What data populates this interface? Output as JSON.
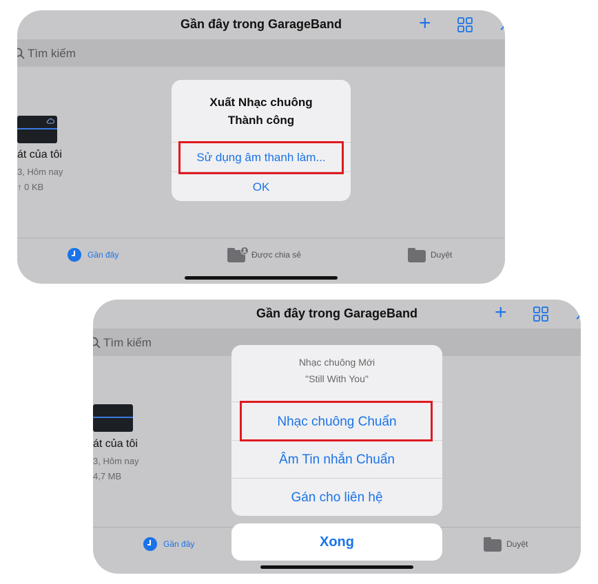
{
  "screen1": {
    "title": "Gần đây trong GarageBand",
    "search_placeholder": "Tìm kiếm",
    "file": {
      "name": "át của tôi",
      "date": "3, Hôm nay",
      "size": "↑ 0 KB"
    },
    "alert": {
      "title_line1": "Xuất Nhạc chuông",
      "title_line2": "Thành công",
      "use_sound_label": "Sử dụng âm thanh làm...",
      "ok_label": "OK"
    },
    "tabs": [
      {
        "label": "Gần đây",
        "icon": "clock-icon",
        "active": true
      },
      {
        "label": "Được chia sẻ",
        "icon": "shared-folder-icon",
        "active": false
      },
      {
        "label": "Duyệt",
        "icon": "folder-icon",
        "active": false
      }
    ]
  },
  "screen2": {
    "title": "Gần đây trong GarageBand",
    "search_placeholder": "Tìm kiếm",
    "file": {
      "name": "át của tôi",
      "date": "3, Hôm nay",
      "size": "4,7 MB"
    },
    "sheet": {
      "heading": "Nhạc chuông Mới",
      "subheading": "\"Still With You\"",
      "options": [
        "Nhạc chuông Chuẩn",
        "Âm Tin nhắn Chuẩn",
        "Gán cho liên hệ"
      ],
      "done_label": "Xong"
    },
    "tabs": [
      {
        "label": "Gần đây",
        "icon": "clock-icon",
        "active": true
      },
      {
        "label": "Duyệt",
        "icon": "folder-icon",
        "active": false
      }
    ]
  },
  "colors": {
    "accent": "#1a73e8",
    "highlight": "#e0191f",
    "background": "#c7c7c9"
  }
}
